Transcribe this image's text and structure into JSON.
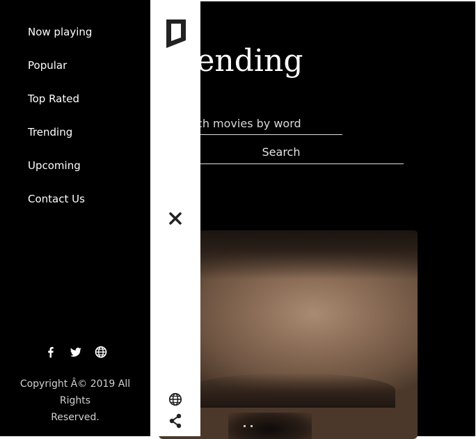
{
  "main": {
    "title": "Trending",
    "search": {
      "placeholder": "Search movies by word",
      "button_label": "Search"
    }
  },
  "menu": {
    "items": [
      {
        "label": "Now playing"
      },
      {
        "label": "Popular"
      },
      {
        "label": "Top Rated"
      },
      {
        "label": "Trending"
      },
      {
        "label": "Upcoming"
      },
      {
        "label": "Contact Us"
      }
    ],
    "social": [
      {
        "icon": "facebook-icon"
      },
      {
        "icon": "twitter-icon"
      },
      {
        "icon": "globe-icon"
      }
    ],
    "copyright_line1": "Copyright Â© 2019 All Rights",
    "copyright_line2": "Reserved."
  },
  "rail": {
    "logo_icon": "logo-icon",
    "close_icon": "close-icon",
    "globe_icon": "globe-icon",
    "share_icon": "share-icon"
  },
  "colors": {
    "background": "#000000",
    "rail": "#ffffff",
    "text": "#ffffff",
    "icon": "#222222"
  }
}
